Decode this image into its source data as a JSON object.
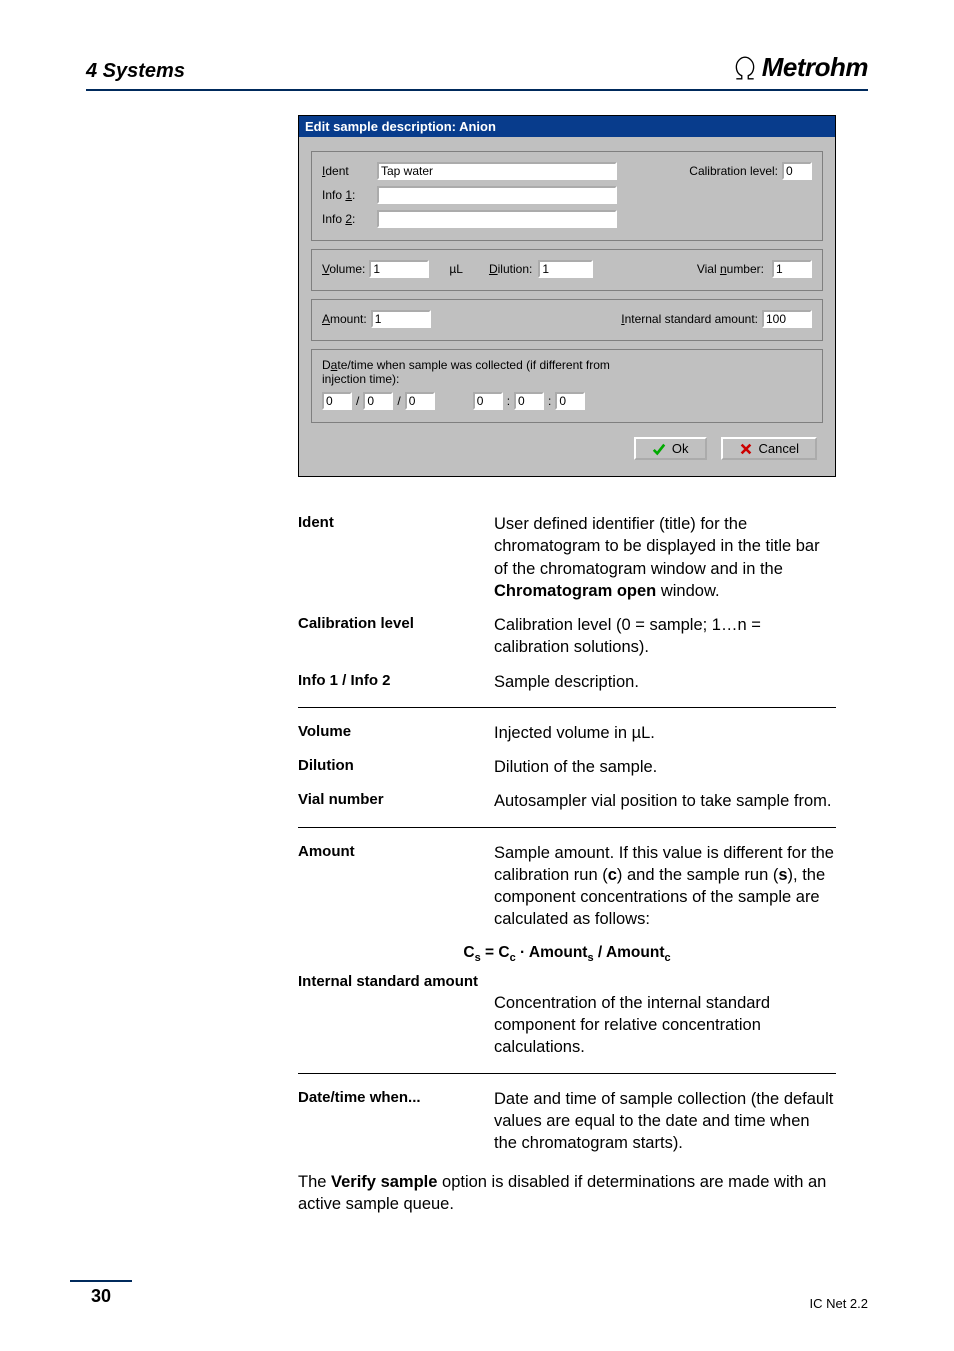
{
  "header": {
    "section": "4 Systems",
    "brand": "Metrohm"
  },
  "dialog": {
    "title": "Edit sample description: Anion",
    "ident": {
      "label": "Ident",
      "acc": "I",
      "value": "Tap water"
    },
    "calib": {
      "label": "Calibration level:",
      "value": "0"
    },
    "info1": {
      "label": "Info 1:",
      "acc": "1",
      "value": ""
    },
    "info2": {
      "label": "Info 2:",
      "acc": "2",
      "value": ""
    },
    "volume": {
      "label": "Volume:",
      "acc": "V",
      "value": "1",
      "unit": "µL"
    },
    "dilution": {
      "label": "Dilution:",
      "acc": "D",
      "value": "1"
    },
    "vial": {
      "label": "Vial number:",
      "acc": "n",
      "value": "1"
    },
    "amount": {
      "label": "Amount:",
      "acc": "A",
      "value": "1"
    },
    "istd": {
      "label": "Internal standard amount:",
      "acc": "I",
      "value": "100"
    },
    "dt": {
      "label": "Date/time when sample was collected (if different from injection time):",
      "acc": "a",
      "d": "0",
      "m": "0",
      "y": "0",
      "h": "0",
      "mi": "0",
      "s": "0"
    },
    "ok": "Ok",
    "cancel": "Cancel"
  },
  "defs": {
    "ident": {
      "term": "Ident",
      "desc_a": "User defined identifier (title) for the chromatogram to be displayed in the title bar of the chromatogram window and in the ",
      "bold": "Chromatogram open",
      "desc_b": " window."
    },
    "calib": {
      "term": "Calibration level",
      "desc": "Calibration level (0 = sample; 1…n = calibration solutions)."
    },
    "info": {
      "term": "Info 1 / Info 2",
      "desc": "Sample description."
    },
    "volume": {
      "term": "Volume",
      "desc": "Injected volume in µL."
    },
    "dilution": {
      "term": "Dilution",
      "desc": "Dilution of the sample."
    },
    "vial": {
      "term": "Vial number",
      "desc": "Autosampler vial position to take sample from."
    },
    "amount": {
      "term": "Amount",
      "desc_a": "Sample amount. If this value is different for the calibration run (",
      "b1": "c",
      "desc_b": ") and the sample run (",
      "b2": "s",
      "desc_c": "), the component concentrations of the sample are calculated as follows:"
    },
    "formula": {
      "lhs": "Cₛ = C꜀ · ",
      "a1": "Amount",
      "s1": "s",
      "sep": " / ",
      "a2": "Amount",
      "s2": "c"
    },
    "istd": {
      "term": "Internal standard amount",
      "desc": "Concentration of the internal standard component for relative concentration calculations."
    },
    "dt": {
      "term": "Date/time when...",
      "desc": "Date and time of sample collection (the default values are equal to the date and time when the chromatogram starts)."
    }
  },
  "tail": {
    "a": "The ",
    "b": "Verify sample",
    "c": " option is disabled if determinations are made with an active sample queue."
  },
  "footer": {
    "page": "30",
    "version": "IC Net 2.2"
  }
}
